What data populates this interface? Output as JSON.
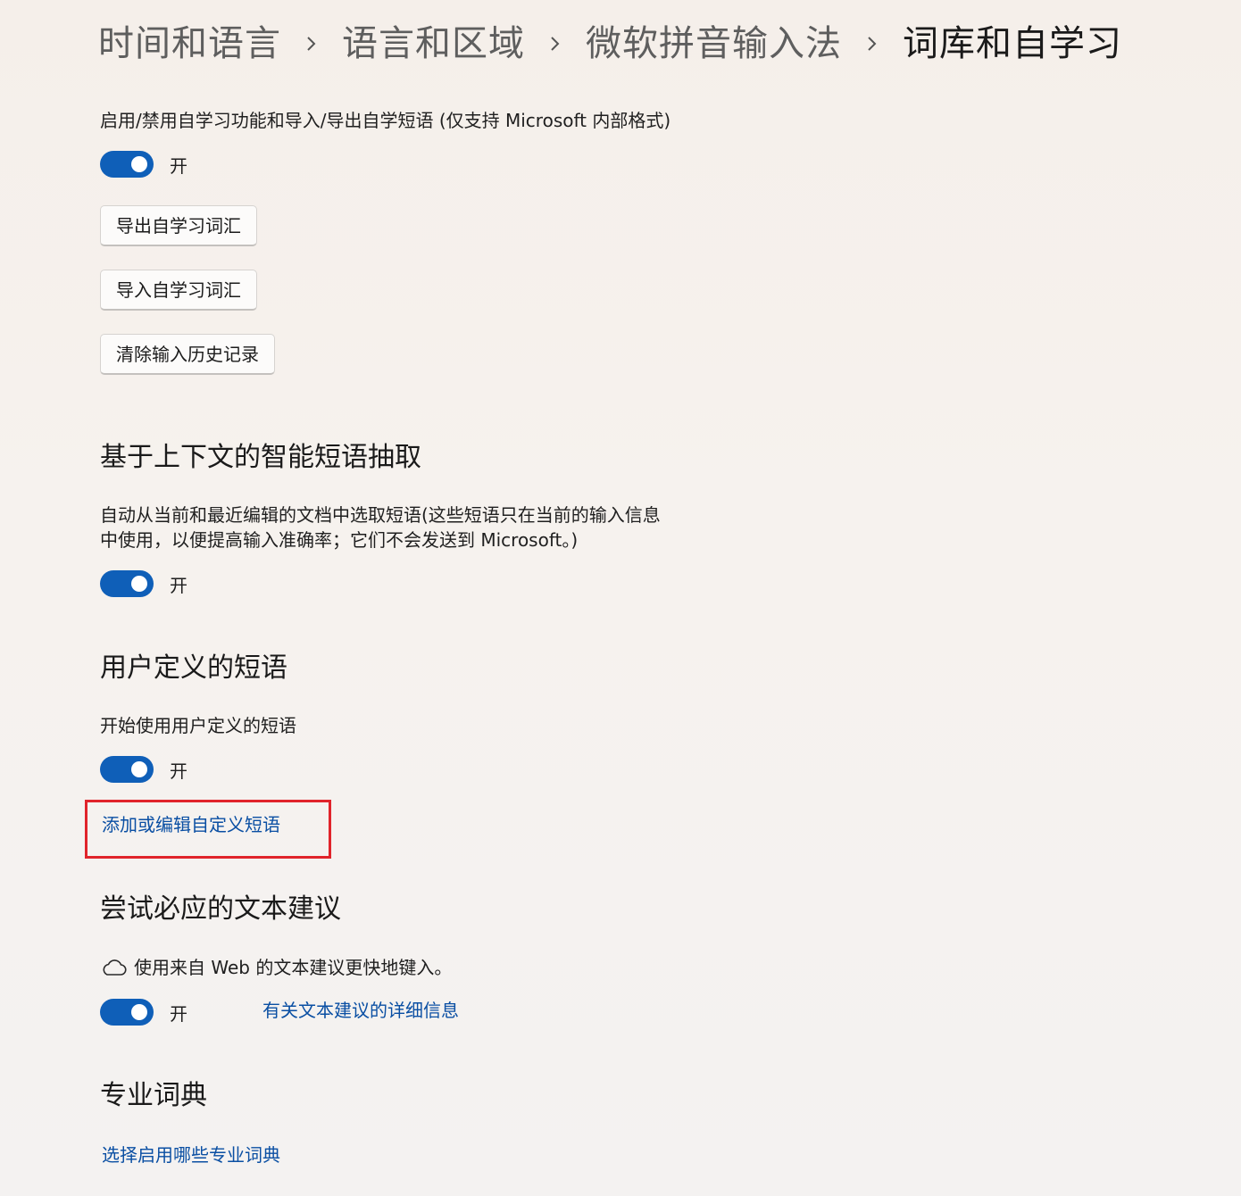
{
  "breadcrumb": {
    "items": [
      "时间和语言",
      "语言和区域",
      "微软拼音输入法",
      "词库和自学习"
    ]
  },
  "self_learning": {
    "description": "启用/禁用自学习功能和导入/导出自学短语 (仅支持 Microsoft 内部格式)",
    "toggle_state": "开",
    "export_button": "导出自学习词汇",
    "import_button": "导入自学习词汇",
    "clear_button": "清除输入历史记录"
  },
  "context_phrases": {
    "title": "基于上下文的智能短语抽取",
    "description_line1": "自动从当前和最近编辑的文档中选取短语(这些短语只在当前的输入信息",
    "description_line2": "中使用，以便提高输入准确率；它们不会发送到 Microsoft。)",
    "toggle_state": "开"
  },
  "user_phrases": {
    "title": "用户定义的短语",
    "description": "开始使用用户定义的短语",
    "toggle_state": "开",
    "edit_link": "添加或编辑自定义短语"
  },
  "text_suggestions": {
    "title": "尝试必应的文本建议",
    "description": "使用来自 Web 的文本建议更快地键入。",
    "toggle_state": "开",
    "details_link": "有关文本建议的详细信息"
  },
  "pro_dictionaries": {
    "title": "专业词典",
    "select_link": "选择启用哪些专业词典"
  },
  "colors": {
    "accent": "#0f5fb8",
    "link": "#0a4fa3",
    "highlight": "#e0242b"
  },
  "icons": {
    "separator": "chevron-right-icon",
    "cloud": "cloud-icon"
  }
}
